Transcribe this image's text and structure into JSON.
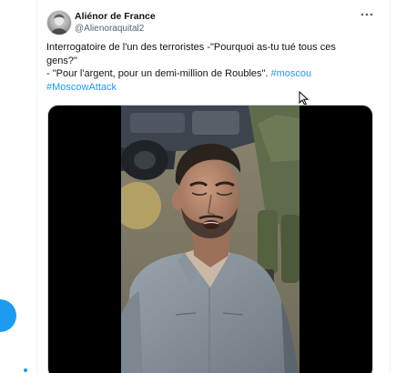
{
  "tweet": {
    "author": {
      "display_name": "Aliénor de France",
      "handle": "@Alienoraquital2"
    },
    "more_icon": "more-horizontal-icon",
    "text": {
      "line1": "Interrogatoire de l'un des terroristes  -\"Pourquoi as-tu tué tous ces",
      "line2": "gens?\"",
      "line3_prefix": "- \"Pour l'argent, pour un demi-million de Roubles\". ",
      "hashtag1": "#moscou",
      "hashtag2": "#MoscowAttack"
    },
    "media": {
      "type": "video"
    }
  },
  "colors": {
    "accent": "#1d9bf0",
    "text_primary": "#0f1419",
    "text_secondary": "#536471",
    "divider": "#eff3f4"
  }
}
